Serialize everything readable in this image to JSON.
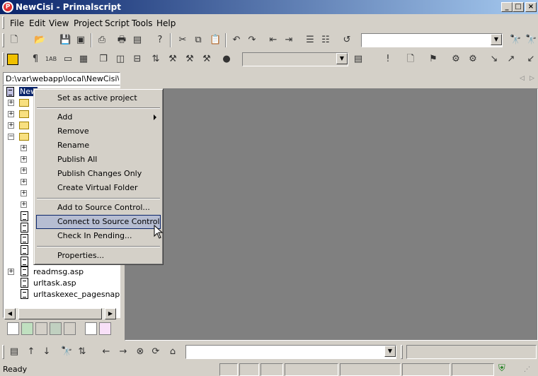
{
  "window": {
    "title": "NewCisi - Primalscript",
    "app_icon": "primalscript-logo-icon",
    "controls": [
      "minimize-icon",
      "maximize-icon",
      "close-icon"
    ]
  },
  "menubar": [
    {
      "label": "File"
    },
    {
      "label": "Edit"
    },
    {
      "label": "View"
    },
    {
      "label": "Project"
    },
    {
      "label": "Script"
    },
    {
      "label": "Tools"
    },
    {
      "label": "Help"
    }
  ],
  "project_panel": {
    "path": "D:\\var\\webapp\\local\\NewCisi\\Ne",
    "root_label": "New",
    "visible_files": [
      "readmsg.asp",
      "urltask.asp",
      "urltaskexec_pagesnap.a"
    ]
  },
  "context_menu": {
    "items": [
      {
        "label": "Set as active project",
        "submenu": false
      },
      {
        "separator": true
      },
      {
        "label": "Add",
        "submenu": true
      },
      {
        "label": "Remove",
        "submenu": false
      },
      {
        "label": "Rename",
        "submenu": false
      },
      {
        "label": "Publish All",
        "submenu": false
      },
      {
        "label": "Publish Changes Only",
        "submenu": false
      },
      {
        "label": "Create Virtual Folder",
        "submenu": false
      },
      {
        "separator": true
      },
      {
        "label": "Add to Source Control...",
        "submenu": false
      },
      {
        "label": "Connect to Source Control",
        "submenu": false,
        "highlighted": true
      },
      {
        "label": "Check In Pending...",
        "submenu": false
      },
      {
        "separator": true
      },
      {
        "label": "Properties...",
        "submenu": false
      }
    ],
    "highlight_color": "#b6bdd2"
  },
  "statusbar": {
    "text": "Ready"
  },
  "colors": {
    "titlebar_start": "#0a246a",
    "titlebar_end": "#a6caf0",
    "editor_background": "#808080",
    "chrome": "#d4d0c8"
  }
}
